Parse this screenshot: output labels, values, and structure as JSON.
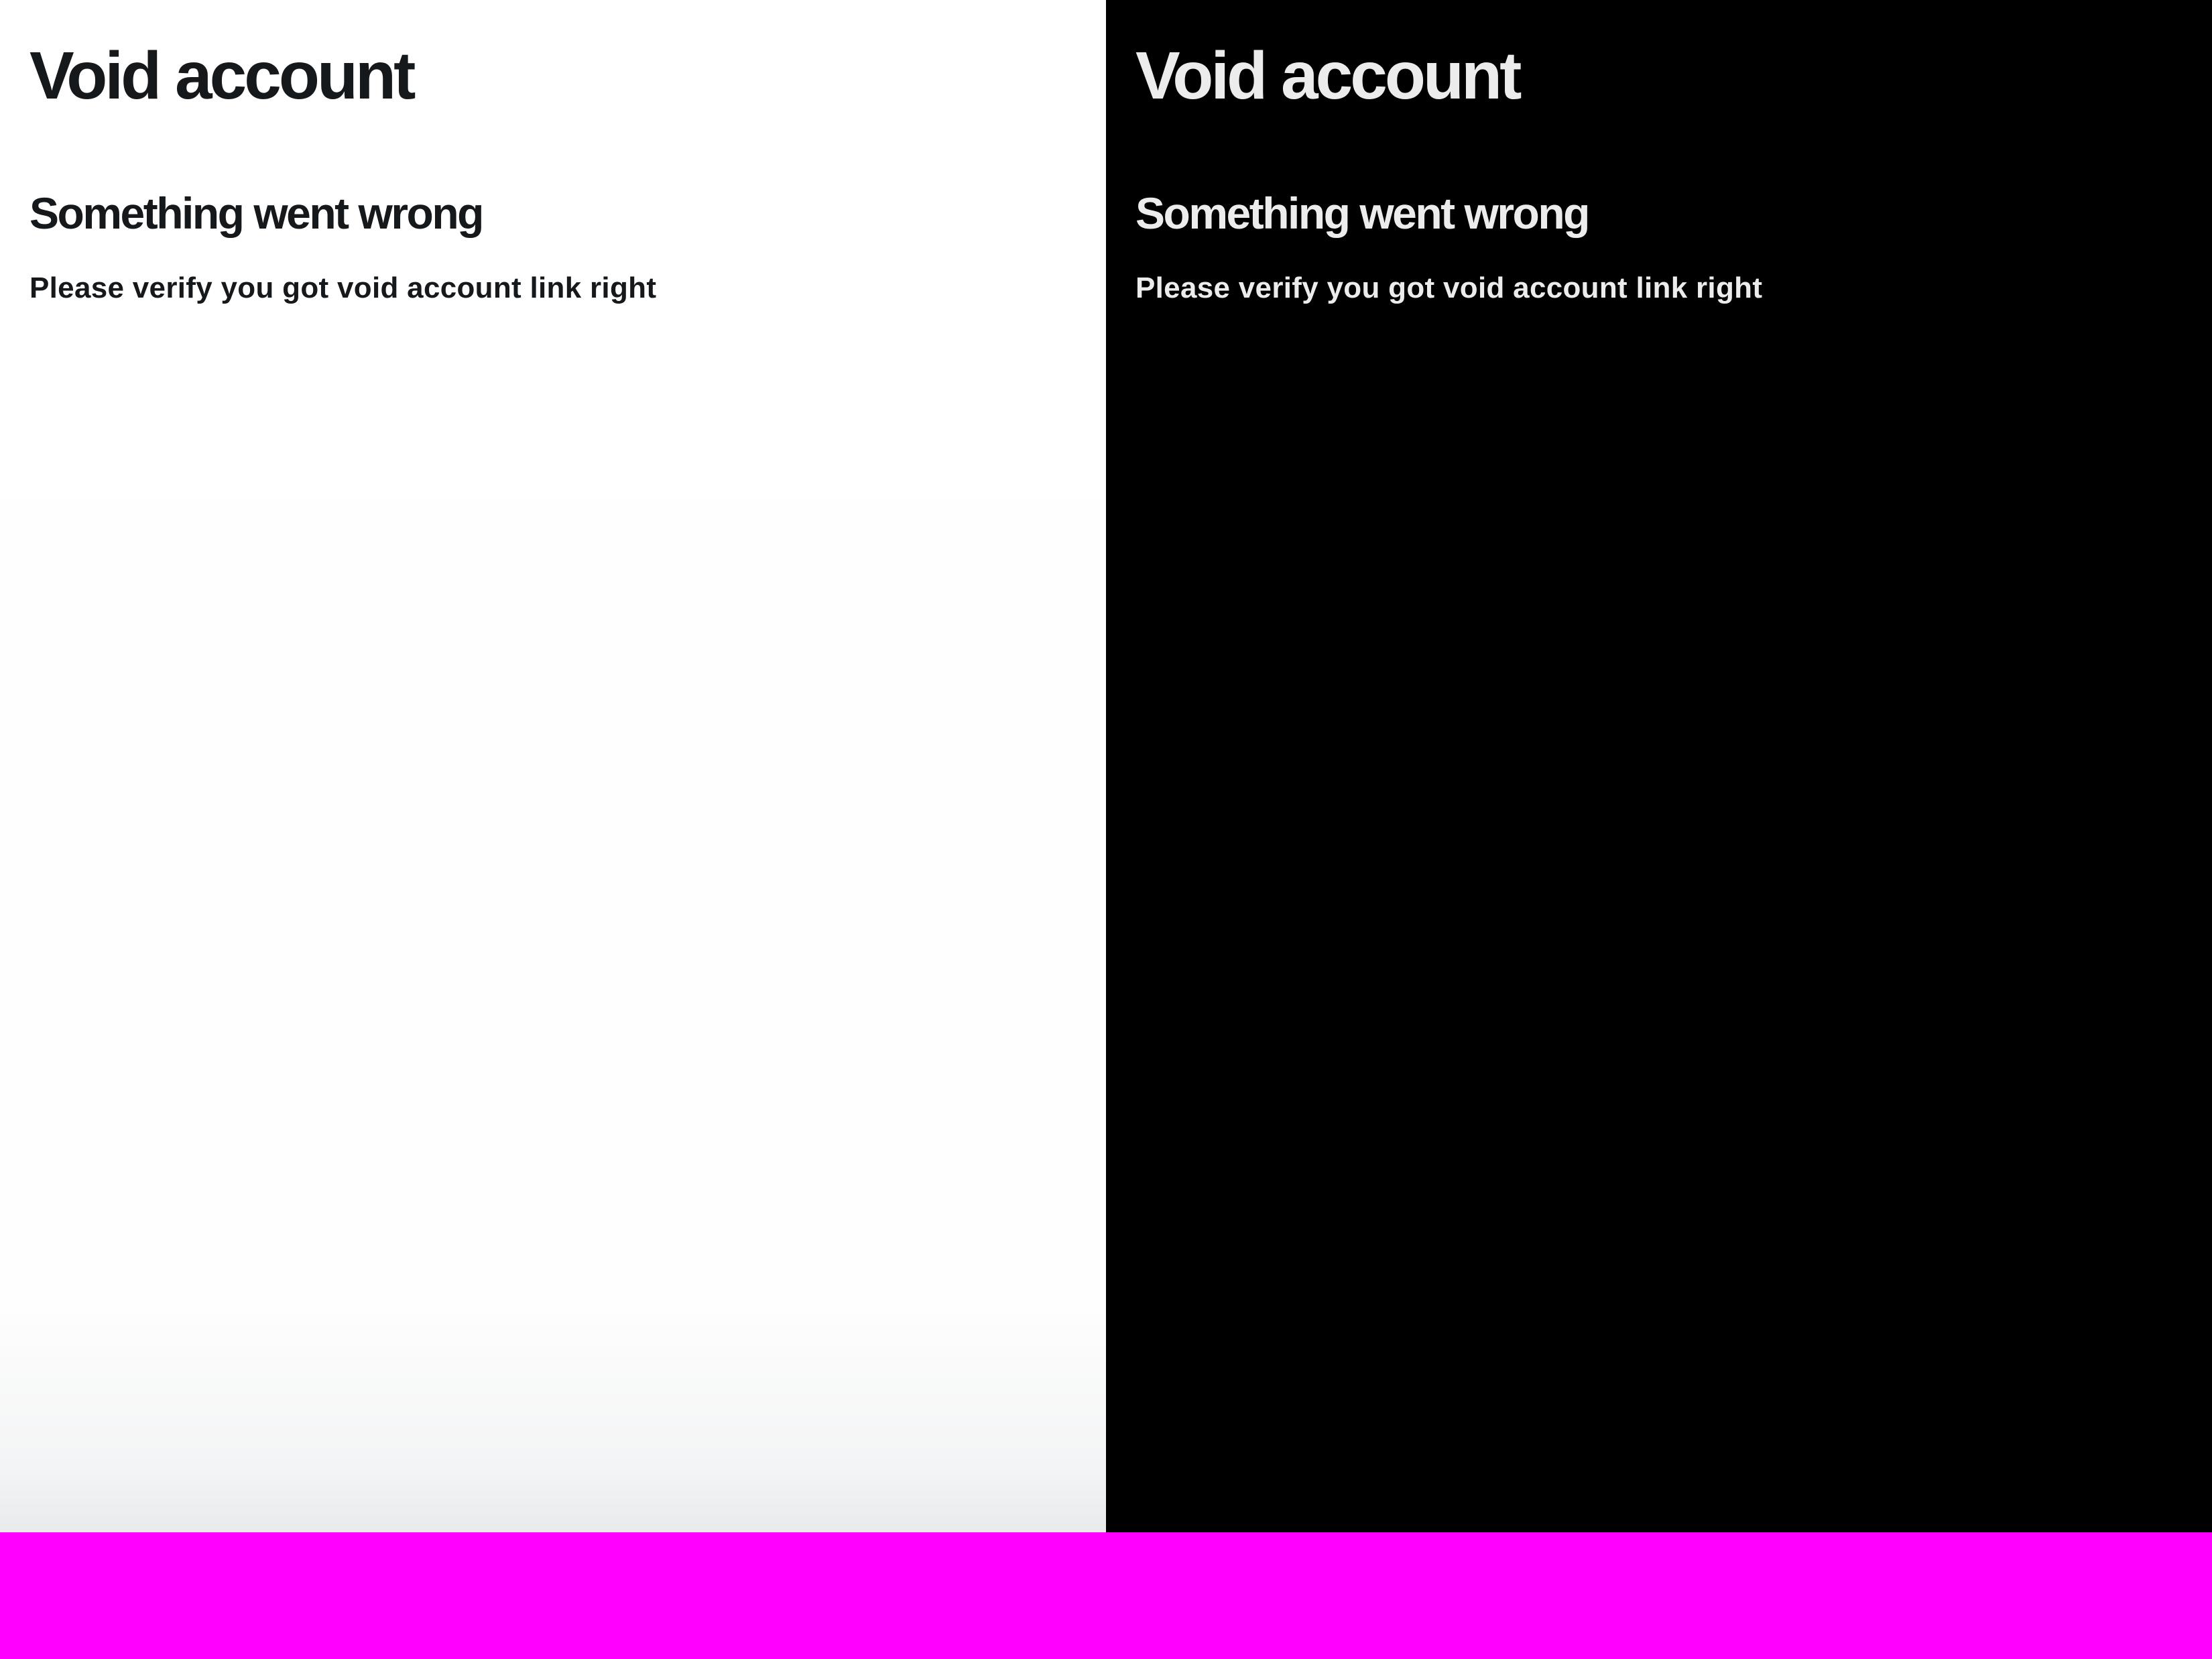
{
  "light_panel": {
    "title": "Void account",
    "error_heading": "Something went wrong",
    "error_message": "Please verify you got void account link right"
  },
  "dark_panel": {
    "title": "Void account",
    "error_heading": "Something went wrong",
    "error_message": "Please verify you got void account link right"
  },
  "colors": {
    "light_background": "#ffffff",
    "light_text": "#16191c",
    "dark_background": "#000000",
    "dark_text": "#ececec",
    "bottom_bar": "#ff00ff"
  }
}
